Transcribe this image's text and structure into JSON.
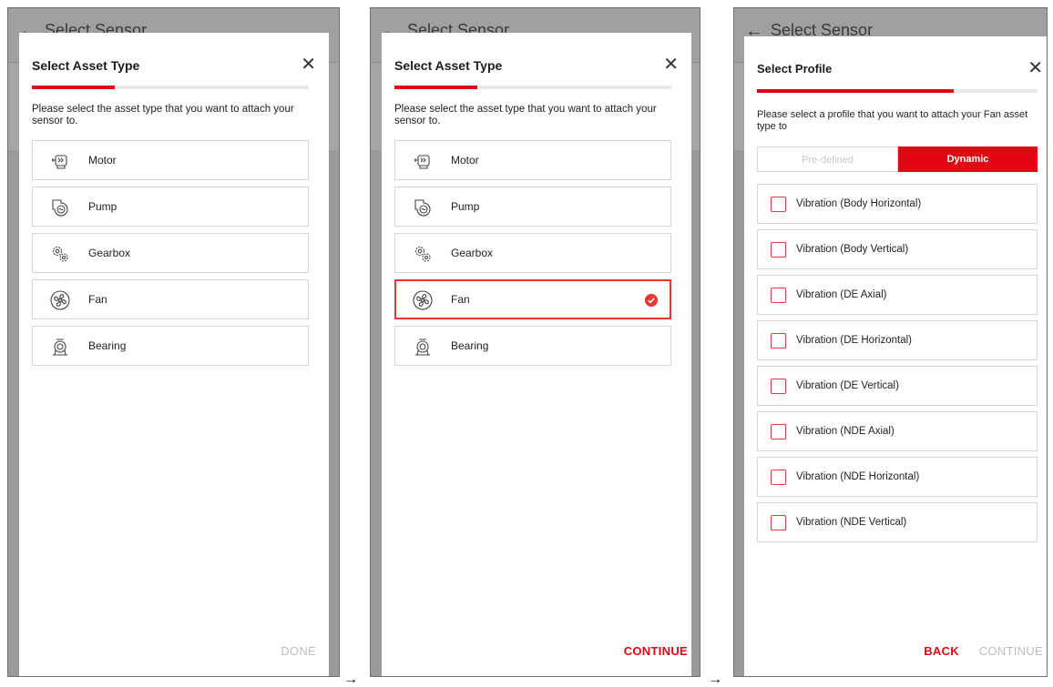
{
  "screens": [
    {
      "appbar_title": "Select Sensor",
      "modal_title": "Select Asset Type",
      "progress": 0.3,
      "prompt": "Please select the asset type that you want to attach your sensor to.",
      "items": [
        {
          "label": "Motor",
          "icon": "motor-icon"
        },
        {
          "label": "Pump",
          "icon": "pump-icon"
        },
        {
          "label": "Gearbox",
          "icon": "gearbox-icon"
        },
        {
          "label": "Fan",
          "icon": "fan-icon"
        },
        {
          "label": "Bearing",
          "icon": "bearing-icon"
        }
      ],
      "selected_item": null,
      "footer_button": "DONE"
    },
    {
      "appbar_title": "Select Sensor",
      "modal_title": "Select Asset Type",
      "progress": 0.3,
      "prompt": "Please select the asset type that you want to attach your sensor to.",
      "items": [
        {
          "label": "Motor",
          "icon": "motor-icon"
        },
        {
          "label": "Pump",
          "icon": "pump-icon"
        },
        {
          "label": "Gearbox",
          "icon": "gearbox-icon"
        },
        {
          "label": "Fan",
          "icon": "fan-icon"
        },
        {
          "label": "Bearing",
          "icon": "bearing-icon"
        }
      ],
      "selected_item": "Fan",
      "footer_button": "CONTINUE"
    },
    {
      "appbar_title": "Select Sensor",
      "modal_title": "Select Profile",
      "progress": 0.7,
      "prompt": "Please select a profile that you want to attach your Fan asset type to",
      "segments": [
        "Pre-defined",
        "Dynamic"
      ],
      "active_segment": "Dynamic",
      "profiles": [
        "Vibration (Body Horizontal)",
        "Vibration (Body Vertical)",
        "Vibration (DE Axial)",
        "Vibration (DE Horizontal)",
        "Vibration (DE Vertical)",
        "Vibration (NDE Axial)",
        "Vibration (NDE Horizontal)",
        "Vibration (NDE Vertical)"
      ],
      "back_button": "BACK",
      "continue_button": "CONTINUE"
    }
  ],
  "flow_arrow": "→",
  "colors": {
    "accent": "#e30613",
    "disabled": "#bdbdbd",
    "overlay": "#9a9a9a"
  }
}
